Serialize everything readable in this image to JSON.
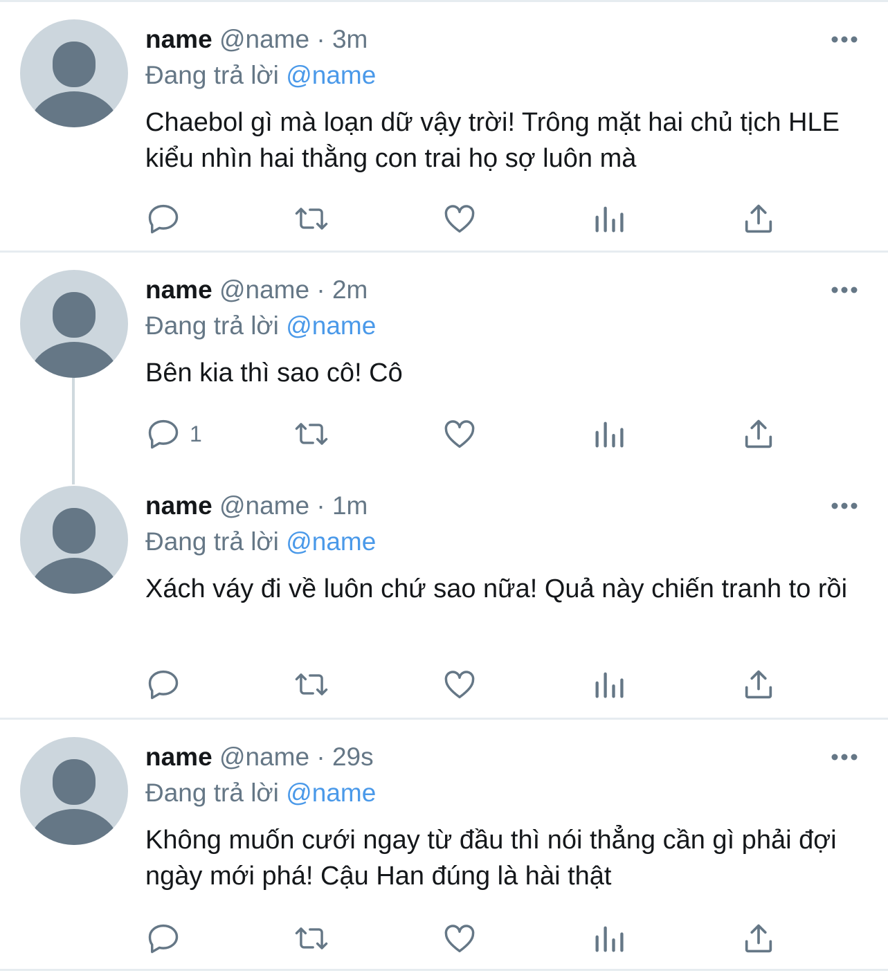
{
  "tweets": [
    {
      "display_name": "name",
      "handle": "@name",
      "separator": "·",
      "time": "3m",
      "reply_prefix": "Đang trả lời",
      "reply_to": "@name",
      "text": "Chaebol gì mà loạn dữ vậy trời! Trông mặt hai chủ tịch HLE kiểu nhìn hai thằng con trai họ sợ luôn mà",
      "reply_count": ""
    },
    {
      "display_name": "name",
      "handle": "@name",
      "separator": "·",
      "time": "2m",
      "reply_prefix": "Đang trả lời",
      "reply_to": "@name",
      "text": "Bên kia thì sao cô! Cô",
      "reply_count": "1"
    },
    {
      "display_name": "name",
      "handle": "@name",
      "separator": "·",
      "time": "1m",
      "reply_prefix": "Đang trả lời",
      "reply_to": "@name",
      "text": "Xách váy đi về luôn chứ sao nữa! Quả này chiến tranh to rồi",
      "reply_count": ""
    },
    {
      "display_name": "name",
      "handle": "@name",
      "separator": "·",
      "time": "29s",
      "reply_prefix": "Đang trả lời",
      "reply_to": "@name",
      "text": "Không muốn cưới ngay từ đầu thì nói thẳng cần gì phải đợi ngày mới phá! Cậu Han đúng là hài thật",
      "reply_count": ""
    }
  ],
  "icons": {
    "reply": "reply-icon",
    "retweet": "retweet-icon",
    "like": "heart-icon",
    "analytics": "analytics-icon",
    "share": "share-icon",
    "more": "more-icon"
  },
  "colors": {
    "text_primary": "#14171a",
    "text_secondary": "#657786",
    "mention": "#4a99e9",
    "icon": "#657786",
    "avatar_bg": "#ccd6dd",
    "avatar_fg": "#657786",
    "separator": "#e6ecf0",
    "thread_line": "#cfd9de"
  }
}
